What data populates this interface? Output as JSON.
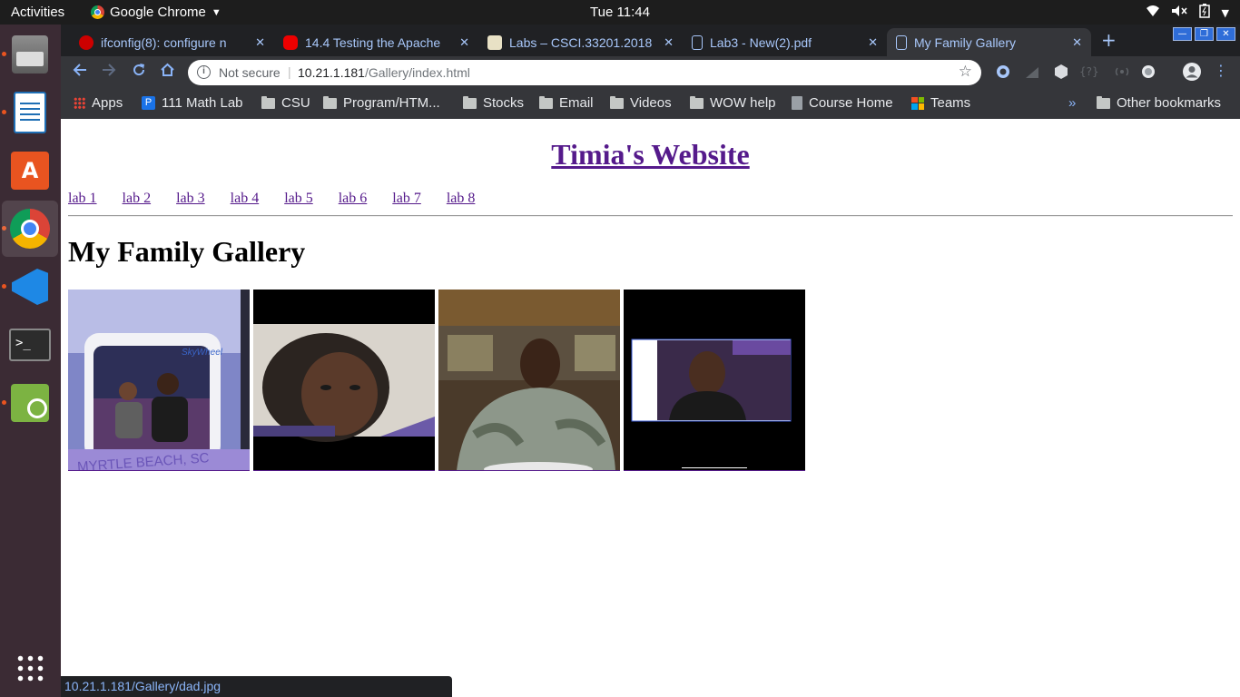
{
  "topbar": {
    "activities": "Activities",
    "app_name": "Google Chrome",
    "clock": "Tue 11:44"
  },
  "dock": {
    "items": [
      "files-icon",
      "writer-icon",
      "software-store-icon",
      "chrome-icon",
      "vscode-icon",
      "terminal-icon",
      "image-viewer-icon",
      "show-apps-icon"
    ]
  },
  "browser": {
    "tabs": [
      {
        "title": "ifconfig(8): configure n",
        "icon": "d-icon"
      },
      {
        "title": "14.4 Testing the Apache",
        "icon": "oracle-icon"
      },
      {
        "title": "Labs – CSCI.33201.2018",
        "icon": "blackboard-icon"
      },
      {
        "title": "Lab3 - New(2).pdf",
        "icon": "document-icon"
      },
      {
        "title": "My Family Gallery",
        "icon": "document-icon"
      }
    ],
    "omnibox": {
      "security": "Not secure",
      "url_host": "10.21.1.181",
      "url_path": "/Gallery/index.html"
    },
    "bookmarks": [
      {
        "label": "Apps",
        "icon": "apps-grid-icon"
      },
      {
        "label": "111 Math Lab",
        "icon": "p-icon"
      },
      {
        "label": "CSU",
        "icon": "folder-icon"
      },
      {
        "label": "Program/HTM...",
        "icon": "folder-icon"
      },
      {
        "label": "Stocks",
        "icon": "folder-icon"
      },
      {
        "label": "Email",
        "icon": "folder-icon"
      },
      {
        "label": "Videos",
        "icon": "folder-icon"
      },
      {
        "label": "WOW help",
        "icon": "folder-icon"
      },
      {
        "label": "Course Home",
        "icon": "page-icon"
      },
      {
        "label": "Teams",
        "icon": "microsoft-icon"
      }
    ],
    "overflow": "»",
    "other_bookmarks": "Other bookmarks",
    "status_url": "10.21.1.181/Gallery/dad.jpg"
  },
  "page": {
    "site_title": "Timia's Website",
    "nav": [
      "lab 1",
      "lab 2",
      "lab 3",
      "lab 4",
      "lab 5",
      "lab 6",
      "lab 7",
      "lab 8"
    ],
    "heading": "My Family Gallery",
    "photos": [
      "couple-photo",
      "woman-selfie",
      "soldier-photo",
      "young-man-photo"
    ]
  },
  "colors": {
    "link": "#551a8b",
    "chrome_dark": "#202124",
    "tab_text": "#a8c7fa",
    "ubuntu_orange": "#e95420"
  }
}
